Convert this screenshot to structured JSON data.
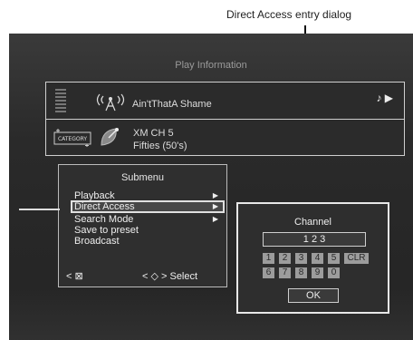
{
  "callout": {
    "label": "Direct Access entry dialog"
  },
  "screen": {
    "title": "Play Information"
  },
  "now_playing": {
    "song": "Ain'tThatA Shame",
    "play_icons": "♪ ▶",
    "category_icon_label": "CATEGORY",
    "channel_line": "XM  CH  5",
    "channel_name": "Fifties (50's)"
  },
  "submenu": {
    "title": "Submenu",
    "items": [
      {
        "label": "Playback",
        "has_arrow": true
      },
      {
        "label": "Direct Access",
        "has_arrow": true,
        "selected": true
      },
      {
        "label": "Search Mode",
        "has_arrow": true
      },
      {
        "label": "Save to preset",
        "has_arrow": false
      },
      {
        "label": "Broadcast",
        "has_arrow": false
      }
    ],
    "arrow_glyph": "▶",
    "footer_back": "< ⊠",
    "footer_select": "< ◇ >  Select"
  },
  "channel_dialog": {
    "title": "Channel",
    "value": "1 2 3",
    "keys_row1": [
      "1",
      "2",
      "3",
      "4",
      "5",
      "CLR"
    ],
    "keys_row2": [
      "6",
      "7",
      "8",
      "9",
      "0"
    ],
    "ok_label": "OK"
  }
}
